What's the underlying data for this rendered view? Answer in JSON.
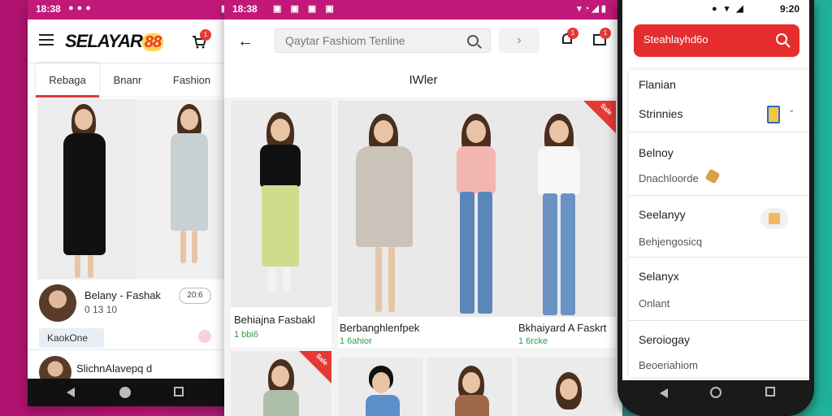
{
  "phone1": {
    "status": {
      "time": "18:38"
    },
    "brand": {
      "text": "SELAYAR",
      "num": "88"
    },
    "cart_badge": "1",
    "tabs": [
      {
        "label": "Rebaga"
      },
      {
        "label": "Bnanr"
      },
      {
        "label": "Fashion"
      }
    ],
    "seller": {
      "name": "Belany - Fashak",
      "sub": "0 13 10",
      "tag": "20:6"
    },
    "chip": "KaokOne",
    "seller2": "SlichnAlavepq d"
  },
  "phone2": {
    "status": {
      "time": "18:38"
    },
    "search": {
      "placeholder": "Qaytar Fashiom Tenline"
    },
    "filter_icon": "chevron-right",
    "notif_badge": "1",
    "cart_badge": "1",
    "section_title": "IWler",
    "cards": [
      {
        "title": "Behiajna Fasbakl",
        "price": "1 bbi6"
      },
      {
        "title": "Berbanghlenfpek",
        "price": "1 6ahior"
      },
      {
        "title": "Bkhaiyard A Faskrt",
        "price": "1 6rcke"
      }
    ],
    "corner_badges": [
      "Sale",
      "Sale"
    ]
  },
  "phone3": {
    "status": {
      "time": "9:20"
    },
    "search_label": "Steahlayhd6o",
    "items": [
      {
        "title": "Flanian",
        "sub": ""
      },
      {
        "title": "Strinnies",
        "sub": ""
      },
      {
        "title": "Belnoy",
        "sub": "Dnachloorde"
      },
      {
        "title": "Seelanyy",
        "sub": "Behjengosicq"
      },
      {
        "title": "Selanyx",
        "sub": "Onlant"
      },
      {
        "title": "Seroiogay",
        "sub": "Beoeriahiom"
      }
    ]
  },
  "colors": {
    "magenta": "#c2187a",
    "red": "#e52d2d",
    "green": "#2e9d4a",
    "teal": "#1fb39a"
  }
}
